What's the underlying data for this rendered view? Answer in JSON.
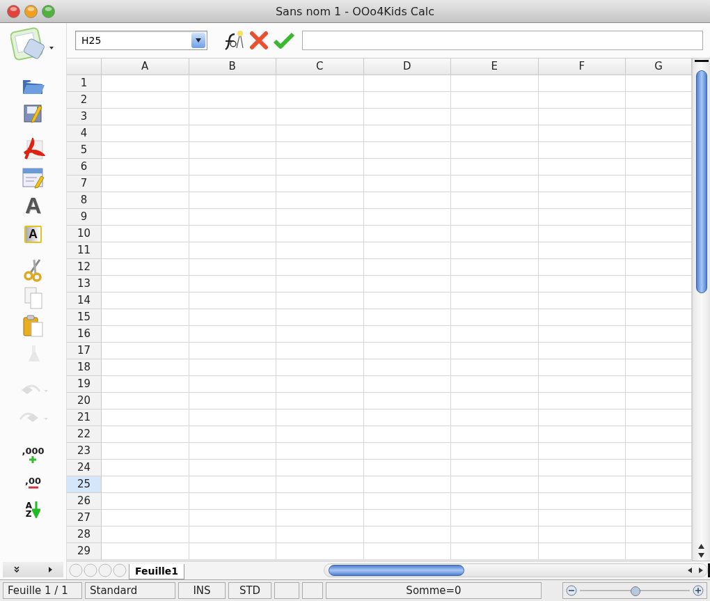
{
  "window": {
    "title": "Sans nom 1 - OOo4Kids Calc"
  },
  "left_toolbar": [
    {
      "items": [
        {
          "kind": "new",
          "disabled": false
        }
      ]
    },
    {
      "items": [
        {
          "kind": "open",
          "disabled": false
        },
        {
          "kind": "edit",
          "disabled": false
        }
      ]
    },
    {
      "items": [
        {
          "kind": "pdf",
          "disabled": false
        },
        {
          "kind": "form",
          "disabled": false
        },
        {
          "kind": "fontwork",
          "glyph": "A",
          "disabled": false
        },
        {
          "kind": "textframe",
          "glyph": "A",
          "disabled": false
        }
      ]
    },
    {
      "items": [
        {
          "kind": "cut",
          "disabled": false
        },
        {
          "kind": "copy",
          "disabled": false
        },
        {
          "kind": "paste",
          "disabled": false
        },
        {
          "kind": "clone",
          "disabled": true
        }
      ]
    },
    {
      "items": [
        {
          "kind": "undo",
          "disabled": true
        },
        {
          "kind": "redo",
          "disabled": true
        }
      ]
    },
    {
      "items": [
        {
          "kind": "decimal-add",
          "glyph": ",000",
          "disabled": false
        },
        {
          "kind": "decimal-remove",
          "glyph": ",00",
          "disabled": false
        },
        {
          "kind": "sort",
          "glyph": "AZ",
          "disabled": false
        }
      ]
    }
  ],
  "formula_bar": {
    "name_box": "H25"
  },
  "sheet": {
    "columns": [
      "A",
      "B",
      "C",
      "D",
      "E",
      "F",
      "G"
    ],
    "rows": [
      {
        "label": "1",
        "selected": false
      },
      {
        "label": "2",
        "selected": false
      },
      {
        "label": "3",
        "selected": false
      },
      {
        "label": "4",
        "selected": false
      },
      {
        "label": "5",
        "selected": false
      },
      {
        "label": "6",
        "selected": false
      },
      {
        "label": "7",
        "selected": false
      },
      {
        "label": "8",
        "selected": false
      },
      {
        "label": "9",
        "selected": false
      },
      {
        "label": "10",
        "selected": false
      },
      {
        "label": "11",
        "selected": false
      },
      {
        "label": "12",
        "selected": false
      },
      {
        "label": "13",
        "selected": false
      },
      {
        "label": "14",
        "selected": false
      },
      {
        "label": "15",
        "selected": false
      },
      {
        "label": "16",
        "selected": false
      },
      {
        "label": "17",
        "selected": false
      },
      {
        "label": "18",
        "selected": false
      },
      {
        "label": "19",
        "selected": false
      },
      {
        "label": "20",
        "selected": false
      },
      {
        "label": "21",
        "selected": false
      },
      {
        "label": "22",
        "selected": false
      },
      {
        "label": "23",
        "selected": false
      },
      {
        "label": "24",
        "selected": false
      },
      {
        "label": "25",
        "selected": true
      },
      {
        "label": "26",
        "selected": false
      },
      {
        "label": "27",
        "selected": false
      },
      {
        "label": "28",
        "selected": false
      },
      {
        "label": "29",
        "selected": false
      }
    ]
  },
  "sheet_tabs": [
    {
      "label": "Feuille1",
      "selected": true
    }
  ],
  "status_bar": {
    "sheet": "Feuille 1 / 1",
    "page_style": "Standard",
    "insert_mode": "INS",
    "selection_mode": "STD",
    "sum": "Somme=0",
    "zoom": {
      "level": 0.5
    }
  }
}
